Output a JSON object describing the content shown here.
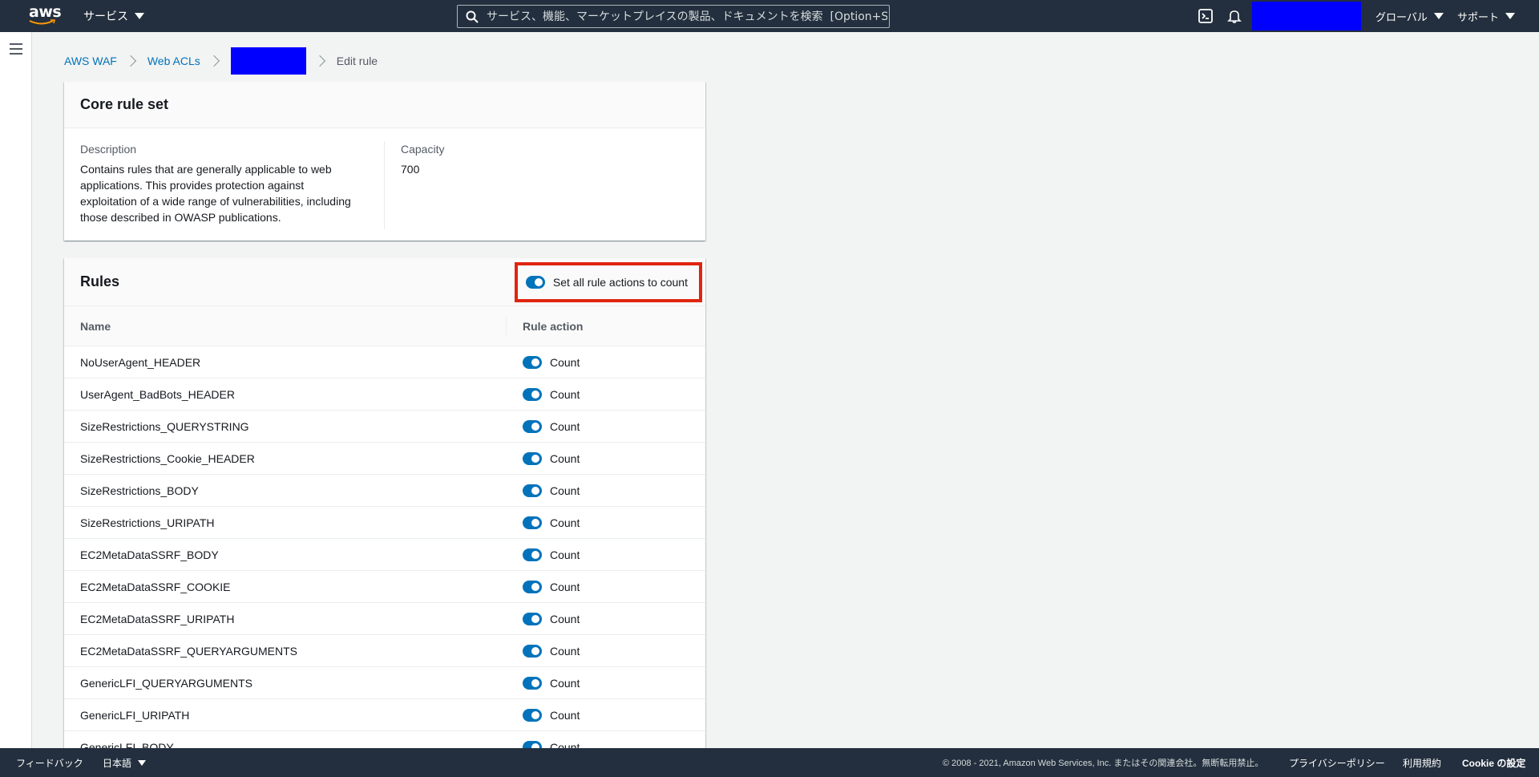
{
  "topnav": {
    "logo_text": "aws",
    "services_label": "サービス",
    "search_placeholder": "サービス、機能、マーケットプレイスの製品、ドキュメントを検索  [Option+S]",
    "region_label": "グローバル",
    "support_label": "サポート",
    "brand_color": "#232f3e",
    "accent_color": "#ff9900"
  },
  "breadcrumb": {
    "items": [
      "AWS WAF",
      "Web ACLs",
      "",
      "Edit rule"
    ]
  },
  "core_rule_set": {
    "title": "Core rule set",
    "description_label": "Description",
    "description_lines": [
      "Contains rules that are generally applicable to web",
      "applications. This provides protection against",
      "exploitation of a wide range of vulnerabilities, including",
      "those described in OWASP publications."
    ],
    "capacity_label": "Capacity",
    "capacity_value": "700"
  },
  "rules": {
    "title": "Rules",
    "set_all_label": "Set all rule actions to count",
    "set_all_enabled": true,
    "columns": [
      "Name",
      "Rule action"
    ],
    "rows": [
      {
        "name": "NoUserAgent_HEADER",
        "action": "Count"
      },
      {
        "name": "UserAgent_BadBots_HEADER",
        "action": "Count"
      },
      {
        "name": "SizeRestrictions_QUERYSTRING",
        "action": "Count"
      },
      {
        "name": "SizeRestrictions_Cookie_HEADER",
        "action": "Count"
      },
      {
        "name": "SizeRestrictions_BODY",
        "action": "Count"
      },
      {
        "name": "SizeRestrictions_URIPATH",
        "action": "Count"
      },
      {
        "name": "EC2MetaDataSSRF_BODY",
        "action": "Count"
      },
      {
        "name": "EC2MetaDataSSRF_COOKIE",
        "action": "Count"
      },
      {
        "name": "EC2MetaDataSSRF_URIPATH",
        "action": "Count"
      },
      {
        "name": "EC2MetaDataSSRF_QUERYARGUMENTS",
        "action": "Count"
      },
      {
        "name": "GenericLFI_QUERYARGUMENTS",
        "action": "Count"
      },
      {
        "name": "GenericLFI_URIPATH",
        "action": "Count"
      },
      {
        "name": "GenericLFI_BODY",
        "action": "Count"
      }
    ]
  },
  "footer": {
    "feedback": "フィードバック",
    "language": "日本語",
    "copyright": "© 2008 - 2021, Amazon Web Services, Inc. またはその関連会社。無断転用禁止。",
    "privacy": "プライバシーポリシー",
    "terms": "利用規約",
    "cookie": "Cookie の設定"
  }
}
